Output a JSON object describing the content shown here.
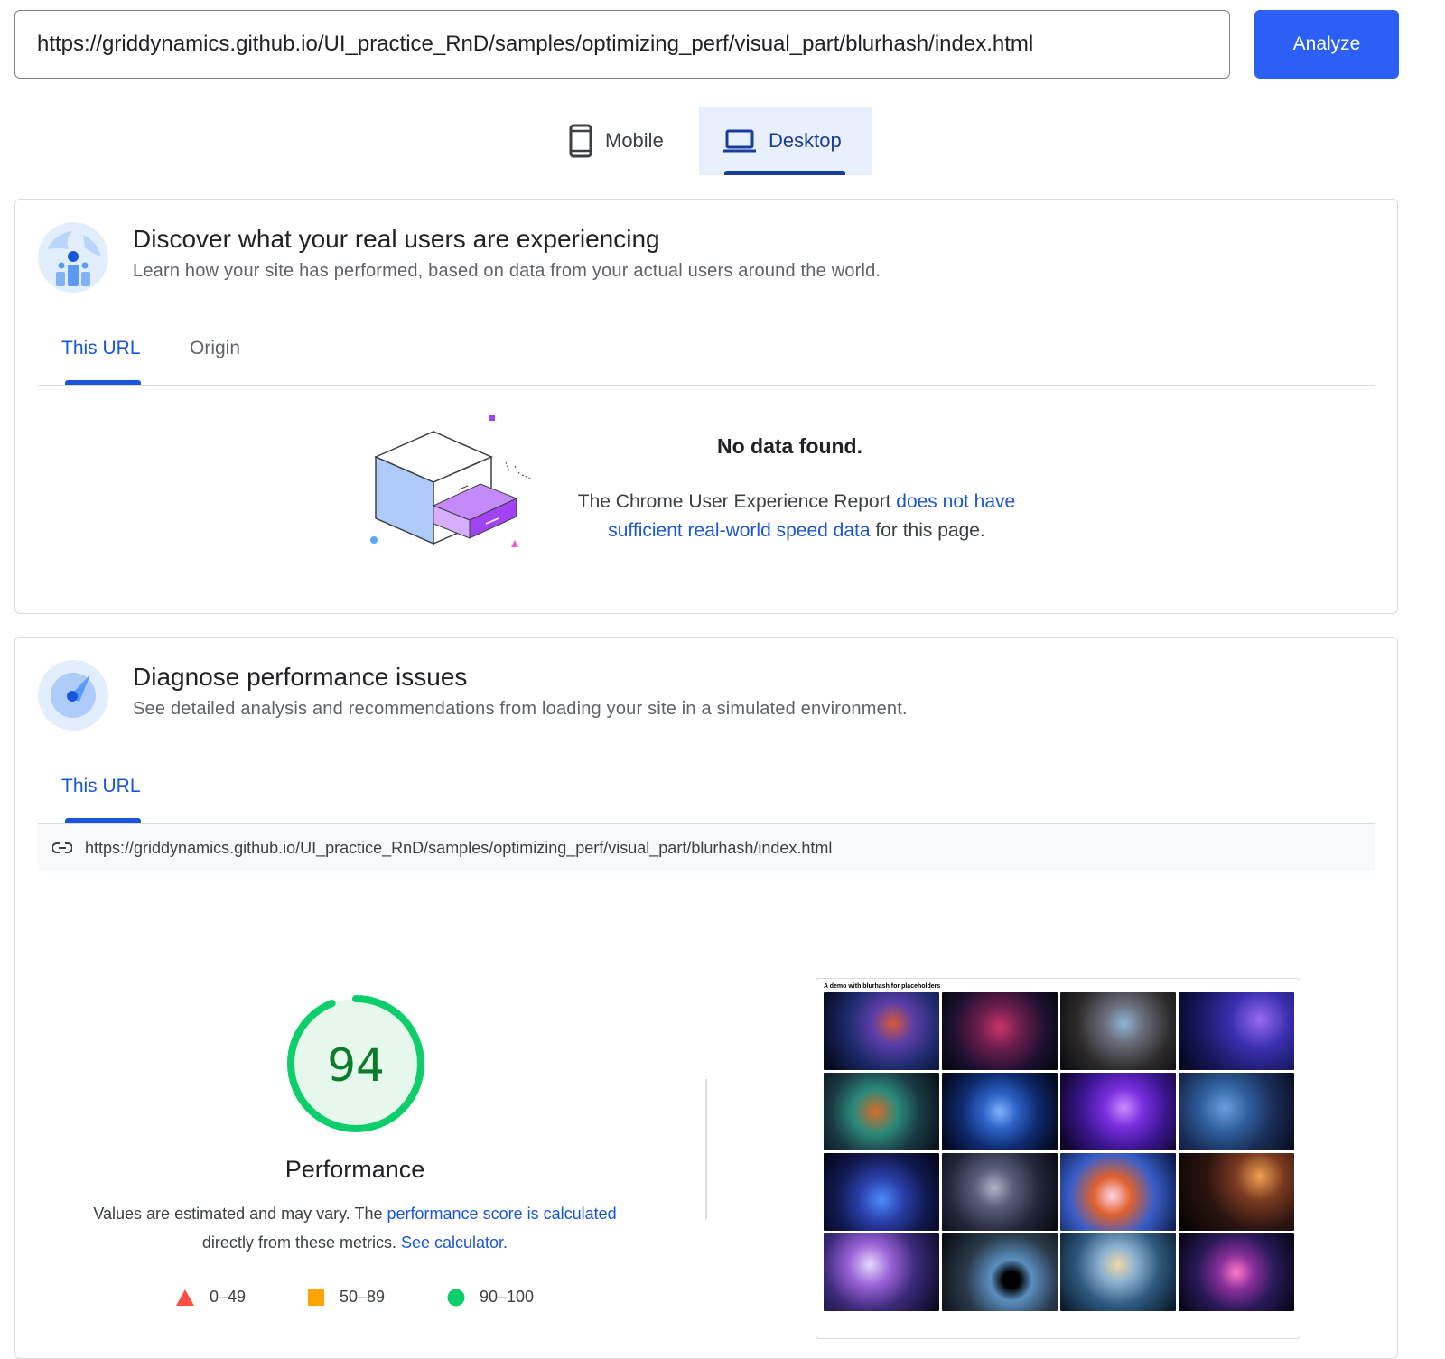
{
  "search": {
    "url_value": "https://griddynamics.github.io/UI_practice_RnD/samples/optimizing_perf/visual_part/blurhash/index.html",
    "analyze_label": "Analyze"
  },
  "device_tabs": {
    "mobile_label": "Mobile",
    "desktop_label": "Desktop",
    "selected": "Desktop"
  },
  "crux": {
    "title": "Discover what your real users are experiencing",
    "subtitle": "Learn how your site has performed, based on data from your actual users around the world.",
    "tabs": {
      "this_url": "This URL",
      "origin": "Origin"
    },
    "no_data_title": "No data found.",
    "no_data_prefix": "The Chrome User Experience Report ",
    "no_data_link": "does not have sufficient real-world speed data",
    "no_data_suffix": " for this page."
  },
  "lab": {
    "title": "Diagnose performance issues",
    "subtitle": "See detailed analysis and recommendations from loading your site in a simulated environment.",
    "tab_this_url": "This URL",
    "tested_url": "https://griddynamics.github.io/UI_practice_RnD/samples/optimizing_perf/visual_part/blurhash/index.html",
    "score": "94",
    "score_fraction": 0.94,
    "score_color": "#0cce6b",
    "score_label": "Performance",
    "explain_prefix": "Values are estimated and may vary. The ",
    "explain_link": "performance score is calculated",
    "explain_middle": "directly from these metrics. ",
    "calculator_link": "See calculator.",
    "legend": [
      {
        "range": "0–49",
        "shape": "triangle",
        "color": "#ff4e42"
      },
      {
        "range": "50–89",
        "shape": "square",
        "color": "#ffa400"
      },
      {
        "range": "90–100",
        "shape": "circle",
        "color": "#0cce6b"
      }
    ],
    "screenshot_caption": "A demo with blurhash for placeholders"
  },
  "colors": {
    "accent": "#2b5ff5",
    "link": "#1a56db"
  }
}
